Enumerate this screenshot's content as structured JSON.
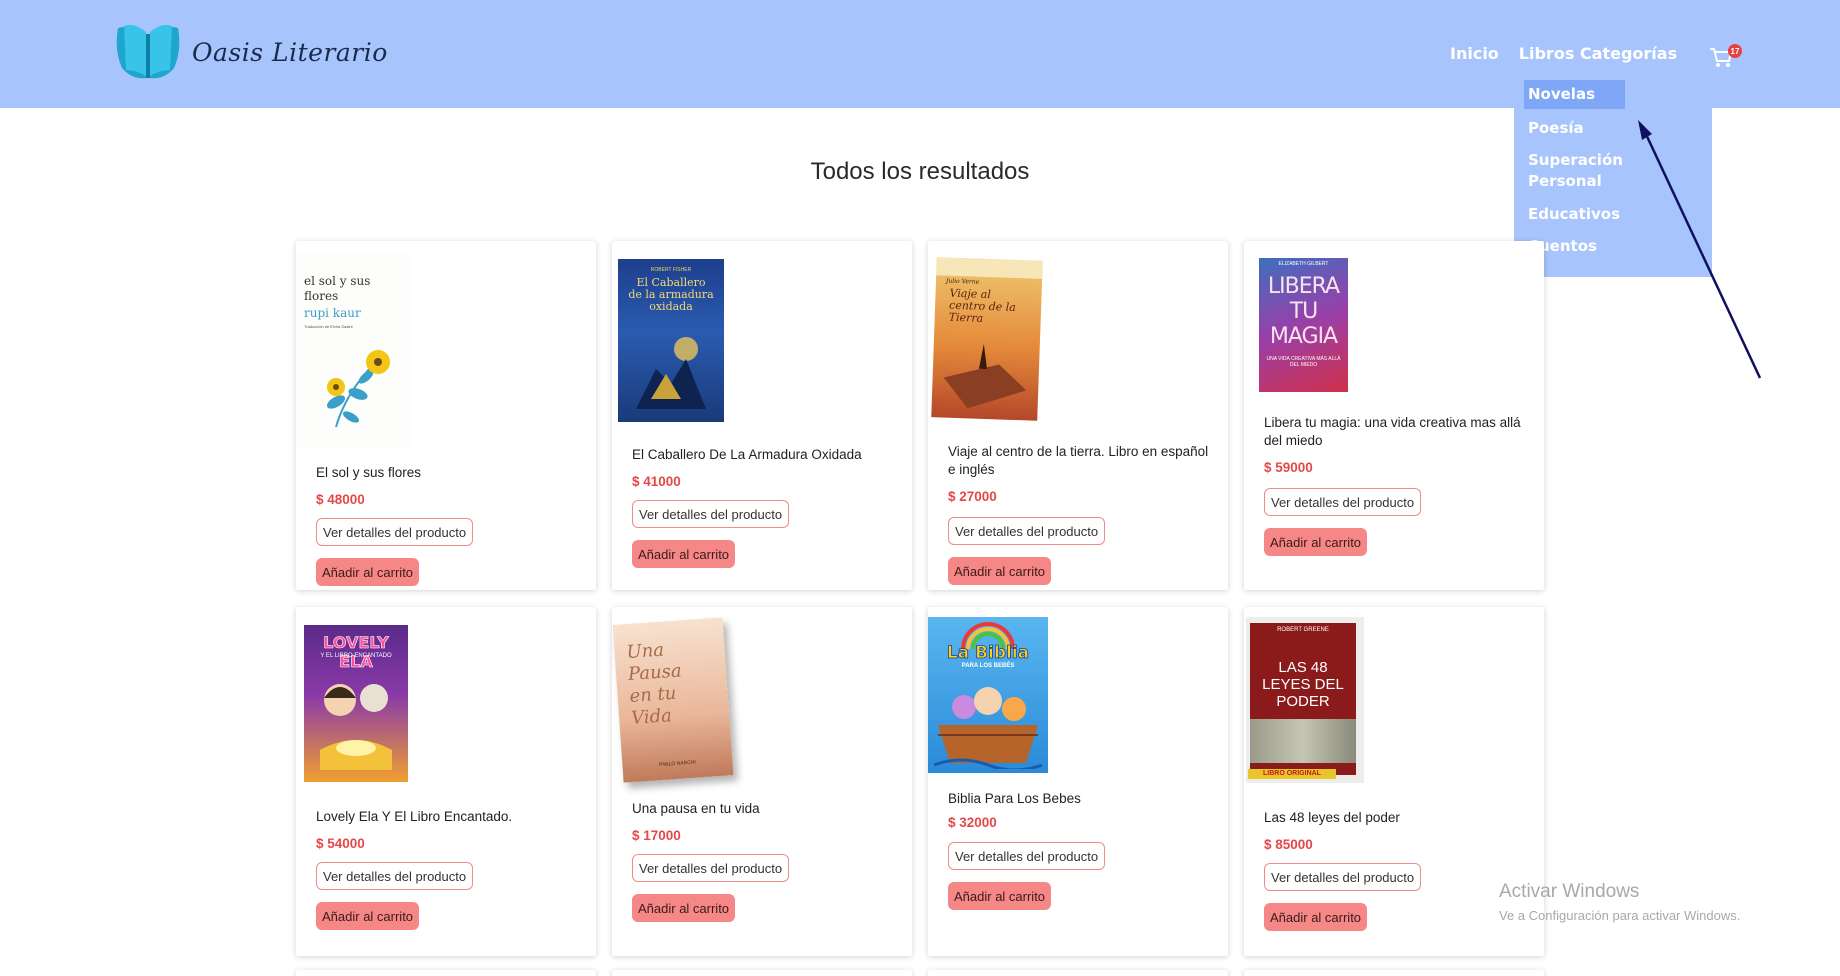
{
  "brand": {
    "name": "Oasis Literario"
  },
  "nav": {
    "home": "Inicio",
    "books": "Libros",
    "categories": "Categorías",
    "cart_count": "17"
  },
  "dropdown": [
    "Novelas",
    "Poesía",
    "Superación Personal",
    "Educativos",
    "Cuentos"
  ],
  "main": {
    "title": "Todos los resultados"
  },
  "buttons": {
    "details": "Ver detalles del producto",
    "add": "Añadir al carrito"
  },
  "products": [
    {
      "name": "El sol y sus flores",
      "price": "$ 48000",
      "cover_text": "el sol y sus flores",
      "cover_author": "rupi kaur",
      "cover_sub": "Traducción de Elvira Sastre"
    },
    {
      "name": "El Caballero De La Armadura Oxidada",
      "price": "$ 41000",
      "cover_text": "El Caballero de la armadura oxidada",
      "cover_author": "ROBERT FISHER"
    },
    {
      "name": "Viaje al centro de la tierra. Libro en español e inglés",
      "price": "$ 27000",
      "cover_text": "Viaje al centro de la Tierra",
      "cover_author": "Julio Verne"
    },
    {
      "name": "Libera tu magia: una vida creativa mas allá del miedo",
      "price": "$ 59000",
      "cover_text": "LIBERA TU MAGIA",
      "cover_author": "ELIZABETH GILBERT",
      "cover_sub": "UNA VIDA CREATIVA MÁS ALLÁ DEL MIEDO"
    },
    {
      "name": "Lovely Ela Y El Libro Encantado.",
      "price": "$ 54000",
      "cover_text": "LOVELY ELA",
      "cover_sub": "Y EL LIBRO ENCANTADO"
    },
    {
      "name": "Una pausa en tu vida",
      "price": "$ 17000",
      "cover_text": "Una Pausa en tu Vida",
      "cover_author": "PABLO NARCHI"
    },
    {
      "name": "Biblia Para Los Bebes",
      "price": "$ 32000",
      "cover_text": "La Biblia",
      "cover_sub": "PARA LOS BEBÉS"
    },
    {
      "name": "Las 48 leyes del poder",
      "price": "$ 85000",
      "cover_text": "LAS 48 LEYES DEL PODER",
      "cover_author": "ROBERT GREENE",
      "cover_sub": "LIBRO ORIGINAL"
    }
  ],
  "watermark": {
    "title": "Activar Windows",
    "subtitle": "Ve a Configuración para activar Windows."
  },
  "colors": {
    "header": "#a7c4fc",
    "price": "#e64848",
    "button_fill": "#f68787",
    "button_border": "#f08b8b",
    "annotation_arrow": "#101060"
  }
}
